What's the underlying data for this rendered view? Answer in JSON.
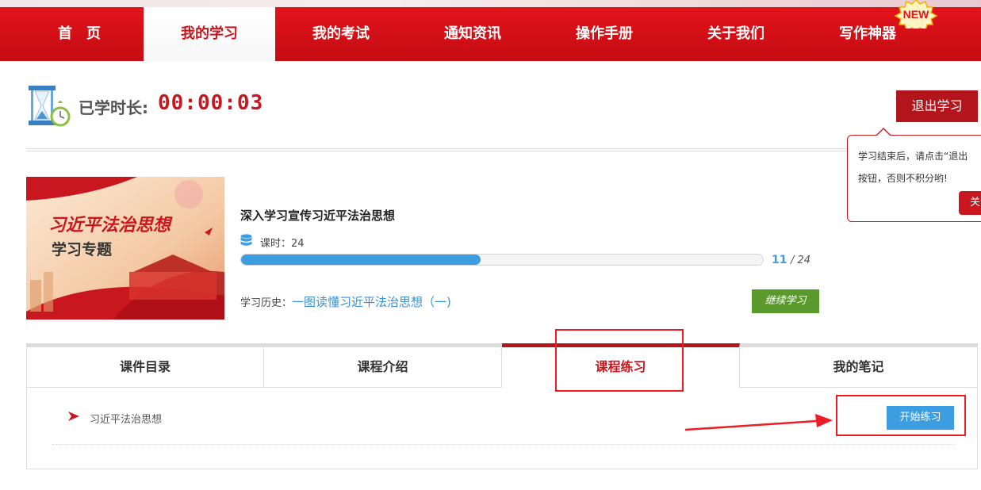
{
  "nav": {
    "items": [
      {
        "label": "首　页"
      },
      {
        "label": "我的学习"
      },
      {
        "label": "我的考试"
      },
      {
        "label": "通知资讯"
      },
      {
        "label": "操作手册"
      },
      {
        "label": "关于我们"
      },
      {
        "label": "写作神器"
      }
    ],
    "active_index": 1,
    "new_badge": "NEW"
  },
  "timer": {
    "label": "已学时长:",
    "value": "00:00:03",
    "icon": "hourglass-icon"
  },
  "exit_button": "退出学习",
  "tooltip": {
    "line1": "学习结束后，请点击“退出",
    "line2": "按钮，否则不积分哟!",
    "close_label": "关"
  },
  "course": {
    "cover": {
      "title_line1": "习近平法治思想",
      "title_line2": "学习专题"
    },
    "title": "深入学习宣传习近平法治思想",
    "hours_label": "课时：24",
    "progress": {
      "current": "11",
      "total": "/ 24",
      "fraction": 0.4583
    },
    "history_label": "学习历史：",
    "history_link": "一图读懂习近平法治思想（一)",
    "continue_label": "继续学习"
  },
  "tabs": [
    {
      "label": "课件目录"
    },
    {
      "label": "课程介绍"
    },
    {
      "label": "课程练习"
    },
    {
      "label": "我的笔记"
    }
  ],
  "active_tab": 2,
  "exercise": {
    "item_label": "习近平法治思想",
    "start_label": "开始练习"
  },
  "colors": {
    "brand_red": "#d20f16",
    "accent_blue": "#3c9ee0",
    "continue_green": "#5a9a2c",
    "annotation_red": "#ee1c24"
  }
}
